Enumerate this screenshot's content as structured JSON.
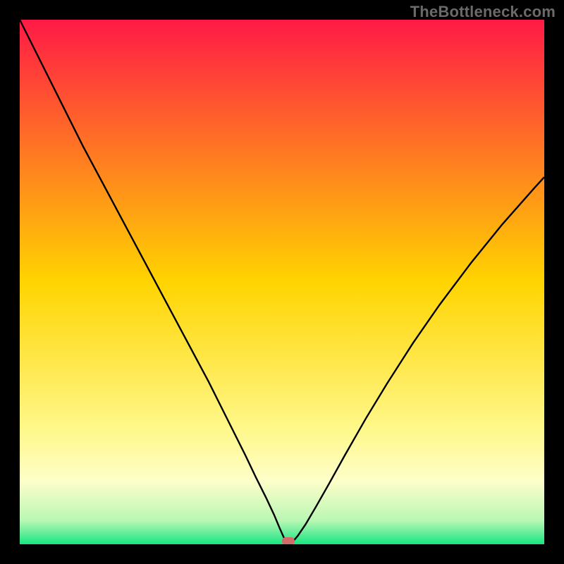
{
  "watermark": "TheBottleneck.com",
  "chart_data": {
    "type": "line",
    "title": "",
    "xlabel": "",
    "ylabel": "",
    "xlim": [
      0,
      100
    ],
    "ylim": [
      0,
      100
    ],
    "grid": false,
    "legend": false,
    "background_gradient": {
      "stops": [
        {
          "pos": 0.0,
          "color": "#ff1a46"
        },
        {
          "pos": 0.5,
          "color": "#ffd400"
        },
        {
          "pos": 0.78,
          "color": "#fff88a"
        },
        {
          "pos": 0.88,
          "color": "#fdfec9"
        },
        {
          "pos": 0.955,
          "color": "#b9f7b4"
        },
        {
          "pos": 1.0,
          "color": "#17e583"
        }
      ]
    },
    "series": [
      {
        "name": "bottleneck-curve",
        "color": "#000000",
        "x": [
          0,
          2,
          5,
          8,
          12,
          16,
          20,
          24,
          28,
          32,
          36,
          40,
          43,
          45,
          47,
          48.5,
          49.5,
          50.3,
          51,
          51.8,
          53,
          54.5,
          56.5,
          59,
          62,
          66,
          70,
          75,
          80,
          86,
          92,
          98,
          100
        ],
        "y": [
          100,
          96,
          90,
          84,
          76,
          68.5,
          61,
          53.5,
          46,
          38.5,
          31,
          23,
          17,
          12.8,
          8.8,
          5.6,
          3.2,
          1.4,
          0.2,
          0.2,
          1.6,
          3.8,
          7.2,
          11.6,
          17,
          24,
          30.6,
          38.4,
          45.6,
          53.6,
          61,
          67.8,
          70
        ]
      }
    ],
    "marker": {
      "name": "optimal-point",
      "x": 51.2,
      "y": 0.6,
      "color": "#d46a6a",
      "shape": "rounded-rect"
    }
  }
}
